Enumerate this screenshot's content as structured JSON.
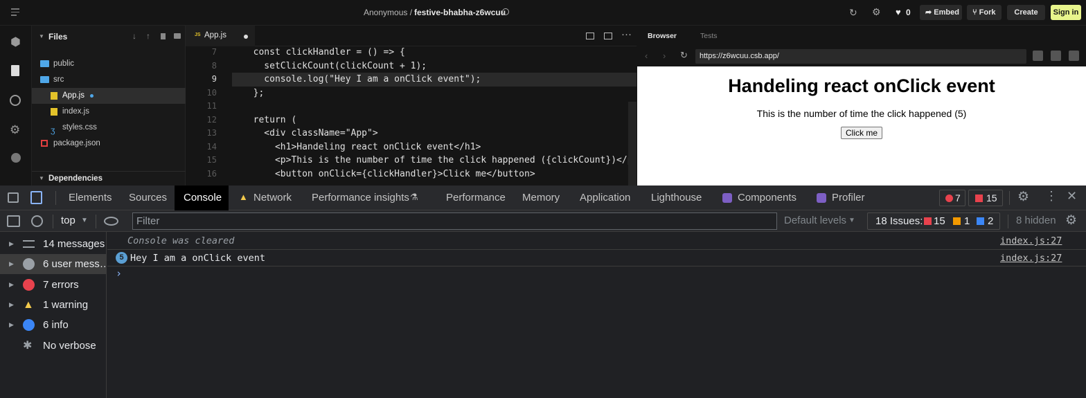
{
  "topbar": {
    "user": "Anonymous /",
    "sandbox": "festive-bhabha-z6wcuu",
    "likes": "0",
    "embed": "Embed",
    "fork": "Fork",
    "create": "Create",
    "signin": "Sign in"
  },
  "files": {
    "title": "Files",
    "items": [
      "public",
      "src",
      "App.js",
      "index.js",
      "styles.css",
      "package.json"
    ],
    "dependencies": "Dependencies"
  },
  "editor": {
    "tab": "App.js",
    "tab_badge": "JS",
    "lines": [
      {
        "n": "7",
        "t": "  const clickHandler = () => {"
      },
      {
        "n": "8",
        "t": "    setClickCount(clickCount + 1);"
      },
      {
        "n": "9",
        "t": "    console.log(\"Hey I am a onClick event\");"
      },
      {
        "n": "10",
        "t": "  };"
      },
      {
        "n": "11",
        "t": ""
      },
      {
        "n": "12",
        "t": "  return ("
      },
      {
        "n": "13",
        "t": "    <div className=\"App\">"
      },
      {
        "n": "14",
        "t": "      <h1>Handeling react onClick event</h1>"
      },
      {
        "n": "15",
        "t": "      <p>This is the number of time the click happened ({clickCount})</p>"
      },
      {
        "n": "16",
        "t": "      <button onClick={clickHandler}>Click me</button>"
      }
    ]
  },
  "preview": {
    "tabs": [
      "Browser",
      "Tests"
    ],
    "url": "https://z6wcuu.csb.app/",
    "heading": "Handeling react onClick event",
    "paragraph": "This is the number of time the click happened (5)",
    "button": "Click me"
  },
  "devtools": {
    "tabs": [
      "Elements",
      "Sources",
      "Console",
      "Network",
      "Performance insights",
      "Performance",
      "Memory",
      "Application",
      "Lighthouse",
      "Components",
      "Profiler"
    ],
    "error_count": "7",
    "issue_count": "15",
    "context": "top",
    "filter_placeholder": "Filter",
    "levels": "Default levels",
    "issues_label": "18 Issues:",
    "issues_err": "15",
    "issues_warn": "1",
    "issues_info": "2",
    "hidden": "8 hidden",
    "sidebar": [
      "14 messages",
      "6 user mess…",
      "7 errors",
      "1 warning",
      "6 info",
      "No verbose"
    ],
    "messages": [
      {
        "text": "Console was cleared",
        "source": "index.js:27"
      },
      {
        "count": "5",
        "text": "Hey I am a onClick event",
        "source": "index.js:27"
      }
    ],
    "prompt": "›"
  },
  "colors": {
    "signin_bg": "#e8f58c",
    "active_tab_bg": "#000000",
    "error_red": "#e8424d",
    "warn_yellow": "#f2c94c",
    "info_blue": "#3b86f6"
  }
}
